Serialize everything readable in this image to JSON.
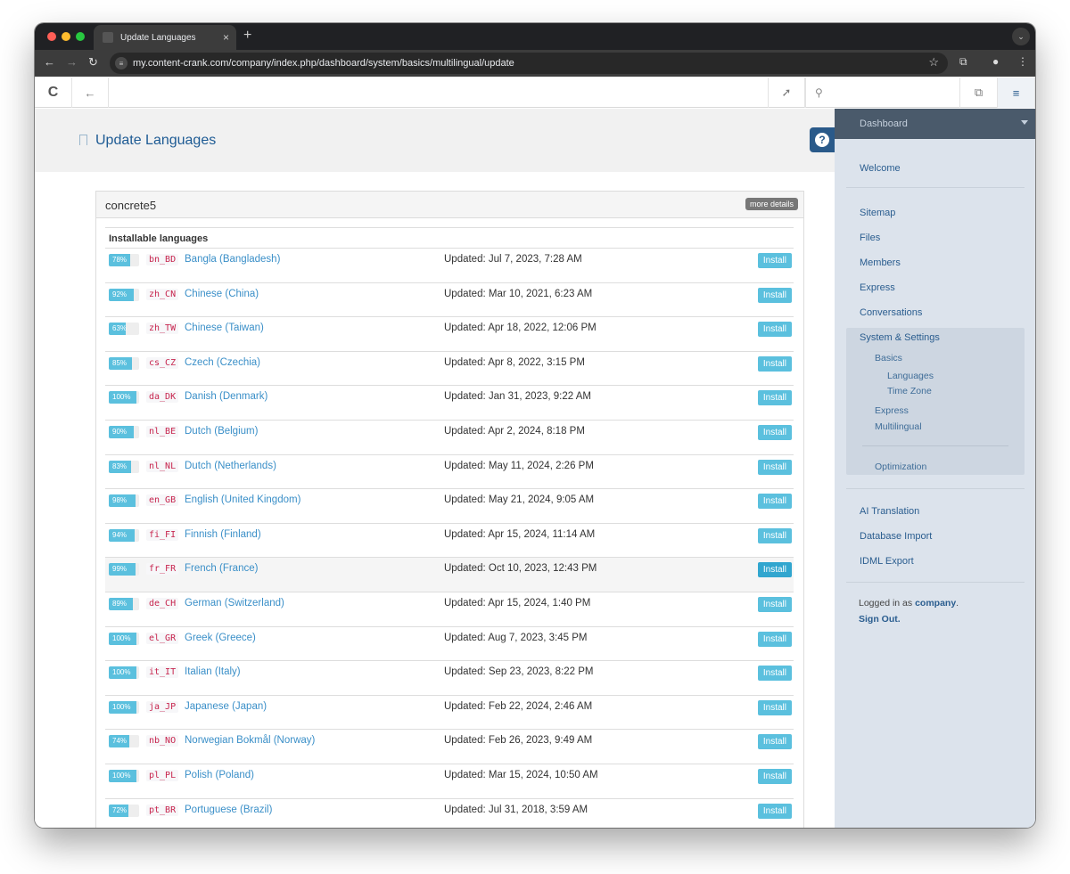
{
  "browser": {
    "tab_title": "Update Languages",
    "url": "my.content-crank.com/company/index.php/dashboard/system/basics/multilingual/update",
    "traffic_lights": [
      "#ff5f57",
      "#febc2e",
      "#28c840"
    ]
  },
  "page": {
    "title": "Update Languages",
    "help_label": "?"
  },
  "panel": {
    "title": "concrete5",
    "more_details": "more details",
    "section_title": "Installable languages",
    "install_label": "Install",
    "languages": [
      {
        "pct": "78%",
        "pct_value": 78,
        "code": "bn_BD",
        "name": "Bangla (Bangladesh)",
        "updated": "Updated: Jul 7, 2023, 7:28 AM"
      },
      {
        "pct": "92%",
        "pct_value": 92,
        "code": "zh_CN",
        "name": "Chinese (China)",
        "updated": "Updated: Mar 10, 2021, 6:23 AM"
      },
      {
        "pct": "63%",
        "pct_value": 63,
        "code": "zh_TW",
        "name": "Chinese (Taiwan)",
        "updated": "Updated: Apr 18, 2022, 12:06 PM"
      },
      {
        "pct": "85%",
        "pct_value": 85,
        "code": "cs_CZ",
        "name": "Czech (Czechia)",
        "updated": "Updated: Apr 8, 2022, 3:15 PM"
      },
      {
        "pct": "100%",
        "pct_value": 100,
        "code": "da_DK",
        "name": "Danish (Denmark)",
        "updated": "Updated: Jan 31, 2023, 9:22 AM"
      },
      {
        "pct": "90%",
        "pct_value": 90,
        "code": "nl_BE",
        "name": "Dutch (Belgium)",
        "updated": "Updated: Apr 2, 2024, 8:18 PM"
      },
      {
        "pct": "83%",
        "pct_value": 83,
        "code": "nl_NL",
        "name": "Dutch (Netherlands)",
        "updated": "Updated: May 11, 2024, 2:26 PM"
      },
      {
        "pct": "98%",
        "pct_value": 98,
        "code": "en_GB",
        "name": "English (United Kingdom)",
        "updated": "Updated: May 21, 2024, 9:05 AM"
      },
      {
        "pct": "94%",
        "pct_value": 94,
        "code": "fi_FI",
        "name": "Finnish (Finland)",
        "updated": "Updated: Apr 15, 2024, 11:14 AM"
      },
      {
        "pct": "99%",
        "pct_value": 99,
        "code": "fr_FR",
        "name": "French (France)",
        "updated": "Updated: Oct 10, 2023, 12:43 PM",
        "highlight": true
      },
      {
        "pct": "89%",
        "pct_value": 89,
        "code": "de_CH",
        "name": "German (Switzerland)",
        "updated": "Updated: Apr 15, 2024, 1:40 PM"
      },
      {
        "pct": "100%",
        "pct_value": 100,
        "code": "el_GR",
        "name": "Greek (Greece)",
        "updated": "Updated: Aug 7, 2023, 3:45 PM"
      },
      {
        "pct": "100%",
        "pct_value": 100,
        "code": "it_IT",
        "name": "Italian (Italy)",
        "updated": "Updated: Sep 23, 2023, 8:22 PM"
      },
      {
        "pct": "100%",
        "pct_value": 100,
        "code": "ja_JP",
        "name": "Japanese (Japan)",
        "updated": "Updated: Feb 22, 2024, 2:46 AM"
      },
      {
        "pct": "74%",
        "pct_value": 74,
        "code": "nb_NO",
        "name": "Norwegian Bokmål (Norway)",
        "updated": "Updated: Feb 26, 2023, 9:49 AM"
      },
      {
        "pct": "100%",
        "pct_value": 100,
        "code": "pl_PL",
        "name": "Polish (Poland)",
        "updated": "Updated: Mar 15, 2024, 10:50 AM"
      },
      {
        "pct": "72%",
        "pct_value": 72,
        "code": "pt_BR",
        "name": "Portuguese (Brazil)",
        "updated": "Updated: Jul 31, 2018, 3:59 AM"
      }
    ]
  },
  "sidebar": {
    "header": "Dashboard",
    "welcome": "Welcome",
    "items": [
      "Sitemap",
      "Files",
      "Members",
      "Express",
      "Conversations"
    ],
    "system": {
      "label": "System & Settings",
      "basics": "Basics",
      "languages": "Languages",
      "time_zone": "Time Zone",
      "express": "Express",
      "multilingual": "Multilingual",
      "optimization": "Optimization"
    },
    "extra": [
      "AI Translation",
      "Database Import",
      "IDML Export"
    ],
    "logged_prefix": "Logged in as ",
    "user": "company",
    "logged_suffix": ".",
    "sign_out": "Sign Out."
  }
}
